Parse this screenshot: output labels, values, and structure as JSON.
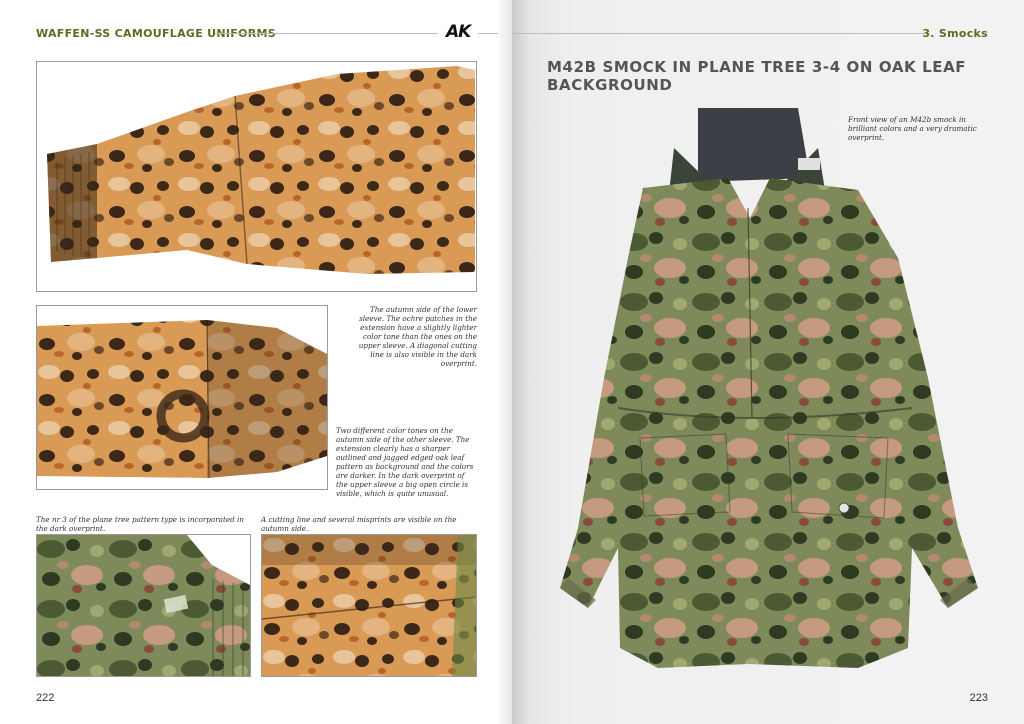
{
  "left_page": {
    "running_head": "WAFFEN-SS CAMOUFLAGE UNIFORMS",
    "logo": "AK",
    "captions": {
      "autumn_lower_sleeve": "The autumn side of the lower sleeve. The ochre patches in the extension have a slightly lighter color tone than the ones on the upper sleeve. A diagonal cutting line is also visible in the dark overprint.",
      "two_color_tones": "Two different color tones on the autumn side of the other sleeve. The extension clearly has a sharper outlined and jagged edged oak leaf pattern as background and the colors are darker. In the dark overprint of the upper sleeve a big open circle is visible, which is quite unusual.",
      "nr3_pattern": "The nr 3 of the plane tree pattern type is incorporated in the dark overprint.",
      "cutting_line": "A cutting line and several misprints are visible on the autumn side."
    },
    "page_number": "222"
  },
  "right_page": {
    "running_head": "3. Smocks",
    "title": "M42B SMOCK IN PLANE TREE 3-4 ON OAK LEAF BACKGROUND",
    "caption": "Front view of an M42b smock in brilliant colors and a very dramatic overprint.",
    "page_number": "223"
  },
  "colors": {
    "running_head": "#5c6b22",
    "autumn_ochre": "#c9782e",
    "camo_dark": "#2f241a",
    "camo_green": "#4a5a3a",
    "camo_pink": "#c79a7e"
  }
}
